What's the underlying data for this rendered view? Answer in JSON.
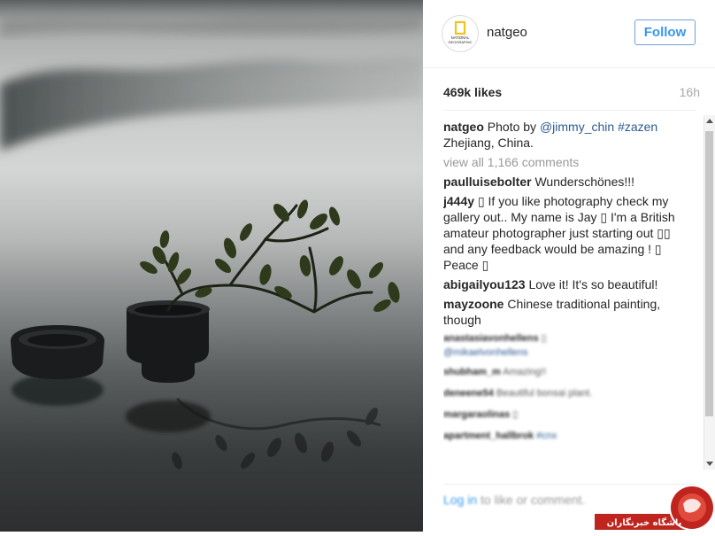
{
  "account": {
    "username": "natgeo",
    "follow_label": "Follow",
    "avatar_lines": [
      "NATIONAL",
      "GEOGRAPHIC"
    ]
  },
  "post": {
    "likes": "469k likes",
    "age": "16h"
  },
  "caption": {
    "username": "natgeo",
    "text_before": "Photo by",
    "mention": "@jimmy_chin",
    "hashtag": "#zazen",
    "text_after": "Zhejiang, China."
  },
  "view_all": "view all 1,166 comments",
  "comments": [
    {
      "username": "paulluisebolter",
      "text": "Wunderschönes!!!"
    },
    {
      "username": "j444y",
      "text": "▯ If you like photography check my gallery out.. My name is Jay ▯ I'm a British amateur photographer just starting out ▯▯ and any feedback would be amazing ! ▯ Peace ▯"
    },
    {
      "username": "abigailyou123",
      "text": "Love it! It's so beautiful!"
    },
    {
      "username": "mayzoone",
      "text": "Chinese traditional painting, though"
    }
  ],
  "blurred_comments": [
    {
      "username": "anastasiavonhellens",
      "text": "▯",
      "link": "@mikaelvonhellens"
    },
    {
      "username": "shubham_m",
      "text": "Amazing!!"
    },
    {
      "username": "deneene54",
      "text": "Beautiful bonsai plant."
    },
    {
      "username": "margaraolinas",
      "text": "▯"
    },
    {
      "username": "apartment_hallbrok",
      "link": "#cnx"
    }
  ],
  "footer": {
    "login": "Log in",
    "rest": "to like or comment."
  },
  "watermark": {
    "text": "باشگاه خبرنگاران"
  }
}
